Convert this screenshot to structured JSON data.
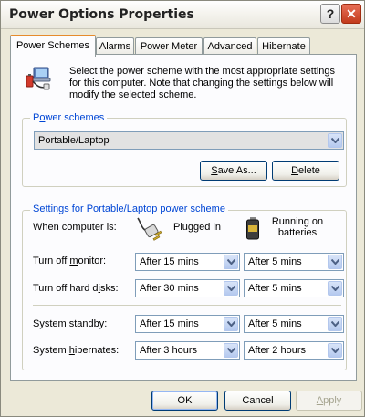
{
  "window": {
    "title": "Power Options Properties",
    "help_glyph": "?",
    "close_glyph": "✕"
  },
  "tabs": [
    {
      "label": "Power Schemes",
      "active": true
    },
    {
      "label": "Alarms",
      "active": false
    },
    {
      "label": "Power Meter",
      "active": false
    },
    {
      "label": "Advanced",
      "active": false
    },
    {
      "label": "Hibernate",
      "active": false
    }
  ],
  "intro": {
    "text": "Select the power scheme with the most appropriate settings for this computer. Note that changing the settings below will modify the selected scheme."
  },
  "schemes": {
    "legend_pre": "P",
    "legend_u": "o",
    "legend_post": "wer schemes",
    "selected": "Portable/Laptop",
    "save_pre": "",
    "save_u": "S",
    "save_post": "ave As...",
    "delete_pre": "",
    "delete_u": "D",
    "delete_post": "elete"
  },
  "settings": {
    "legend": "Settings for Portable/Laptop power scheme",
    "when_label": "When computer is:",
    "plugged_label": "Plugged in",
    "battery_label": "Running on batteries",
    "rows": [
      {
        "pre": "Turn off ",
        "u": "m",
        "post": "onitor:",
        "plugged": "After 15 mins",
        "battery": "After 5 mins"
      },
      {
        "pre": "Turn off hard d",
        "u": "i",
        "post": "sks:",
        "plugged": "After 30 mins",
        "battery": "After 5 mins"
      },
      {
        "pre": "System s",
        "u": "t",
        "post": "andby:",
        "plugged": "After 15 mins",
        "battery": "After 5 mins"
      },
      {
        "pre": "System ",
        "u": "h",
        "post": "ibernates:",
        "plugged": "After 3 hours",
        "battery": "After 2 hours"
      }
    ]
  },
  "footer": {
    "ok": "OK",
    "cancel": "Cancel",
    "apply_pre": "",
    "apply_u": "A",
    "apply_post": "pply"
  },
  "icons": {
    "intro": "power-scheme-icon",
    "plug": "plug-icon",
    "battery": "battery-icon",
    "dropdown": "chevron-down-icon"
  },
  "colors": {
    "accent_tab": "#e68b2c",
    "legend_text": "#0046d5",
    "dialog_bg": "#ece9d8",
    "panel_bg": "#fcfcfe"
  }
}
